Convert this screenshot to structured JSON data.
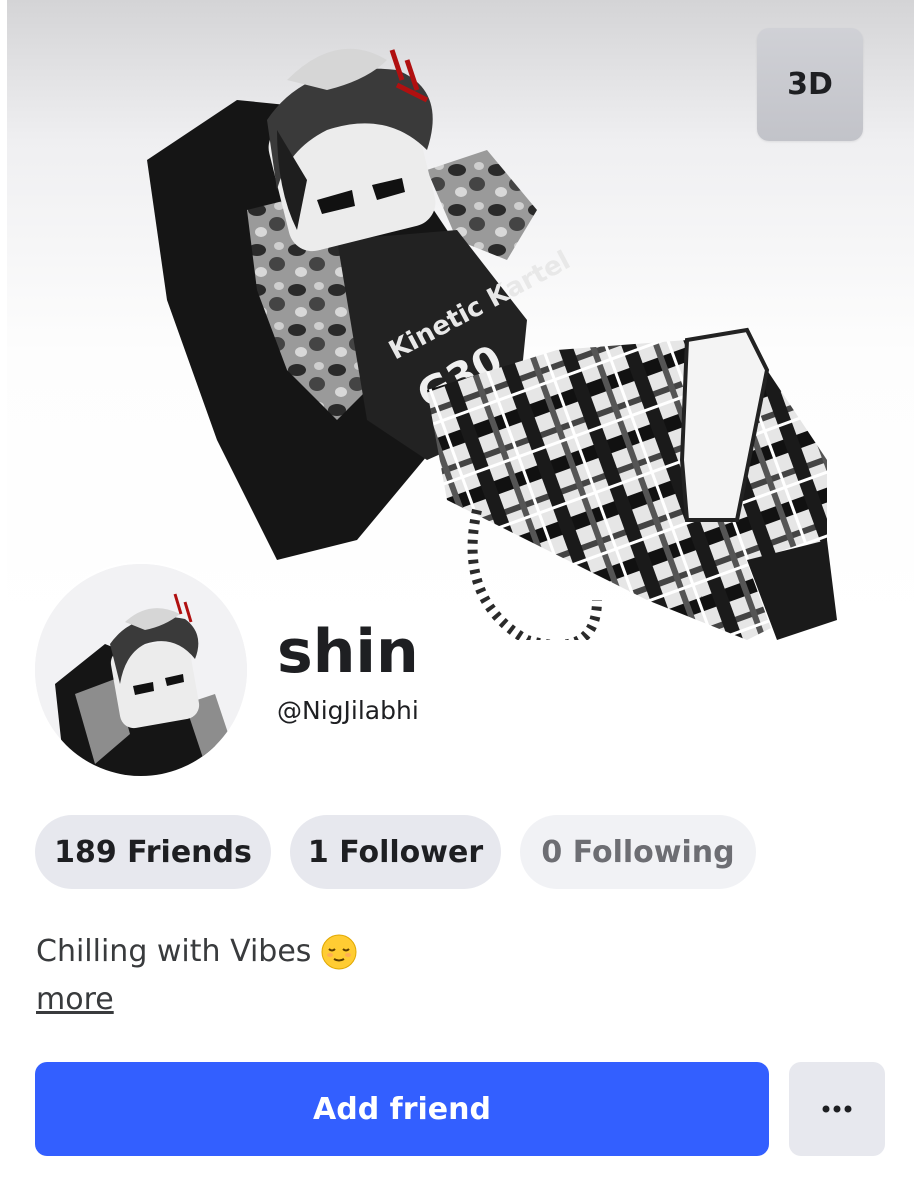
{
  "profile": {
    "display_name": "shin",
    "username": "@NigJilabhi",
    "bio": "Chilling with Vibes",
    "bio_emoji": "relieved-face-icon",
    "more_link": "more"
  },
  "view_toggle": {
    "label": "3D"
  },
  "stats": {
    "friends": "189 Friends",
    "followers": "1 Follower",
    "following": "0 Following"
  },
  "actions": {
    "add_friend": "Add friend",
    "more_options_icon": "ellipsis-icon"
  },
  "avatar_shirt_text": {
    "brand": "Kinetic Kartel",
    "number": "G30"
  },
  "colors": {
    "primary_button": "#335fff",
    "pill_background": "#e7e8ee",
    "text_primary": "#1e1f22",
    "text_muted": "#6d6e73"
  }
}
